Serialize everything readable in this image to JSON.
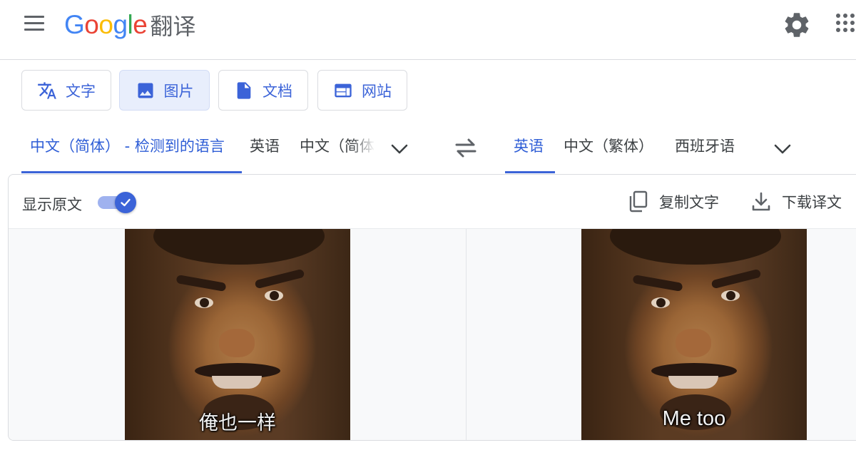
{
  "header": {
    "logo_google": "Google",
    "logo_product": "翻译",
    "logo_letters": [
      "G",
      "o",
      "o",
      "g",
      "l",
      "e"
    ],
    "logo_colors": [
      "#4285F4",
      "#EA4335",
      "#FBBC05",
      "#4285F4",
      "#34A853",
      "#EA4335"
    ]
  },
  "modes": [
    {
      "label": "文字",
      "icon": "translate-icon",
      "active": false
    },
    {
      "label": "图片",
      "icon": "image-icon",
      "active": true
    },
    {
      "label": "文档",
      "icon": "document-icon",
      "active": false
    },
    {
      "label": "网站",
      "icon": "website-icon",
      "active": false
    }
  ],
  "source_langs": {
    "detected": "中文（简体） - 检测到的语言",
    "lang2": "英语",
    "lang3": "中文（简体）"
  },
  "target_langs": {
    "lang1": "英语",
    "lang2": "中文（繁体）",
    "lang3": "西班牙语"
  },
  "panel": {
    "show_original_label": "显示原文",
    "show_original_on": true,
    "copy_label": "复制文字",
    "download_label": "下载译文"
  },
  "images": {
    "source_caption": "俺也一样",
    "translated_caption": "Me too"
  },
  "colors": {
    "accent": "#3b63d8",
    "active_tab_bg": "#e8eefc"
  }
}
